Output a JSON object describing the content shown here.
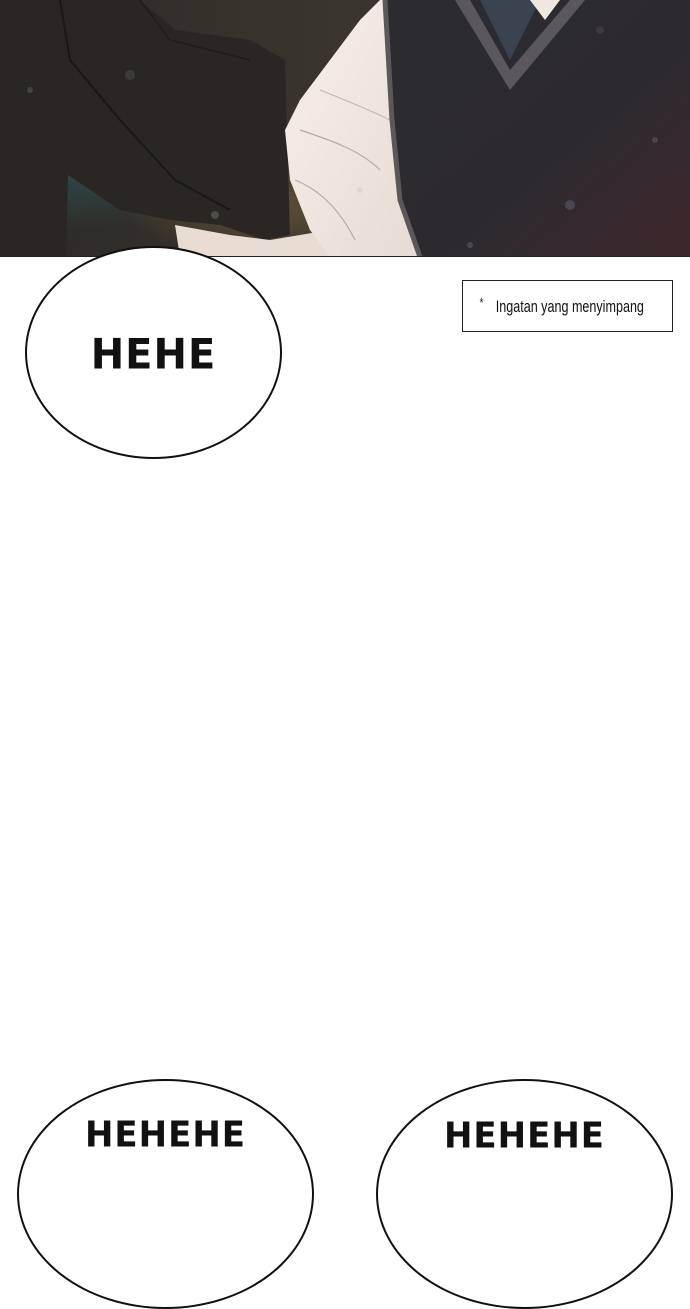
{
  "panel": {
    "illustration": "two-figures-school-uniform-closeup-icon",
    "colors": {
      "dark_jacket": "#2b2724",
      "sweater_vest": "#2e2a30",
      "shirt": "#f3ece6",
      "skin_tone": "#e9dcd2"
    }
  },
  "bubbles": [
    {
      "text": "HEHE"
    },
    {
      "text": "HEHEHE"
    },
    {
      "text": "HEHEHE"
    }
  ],
  "note": {
    "asterisk": "*",
    "text": "Ingatan yang menyimpang"
  }
}
